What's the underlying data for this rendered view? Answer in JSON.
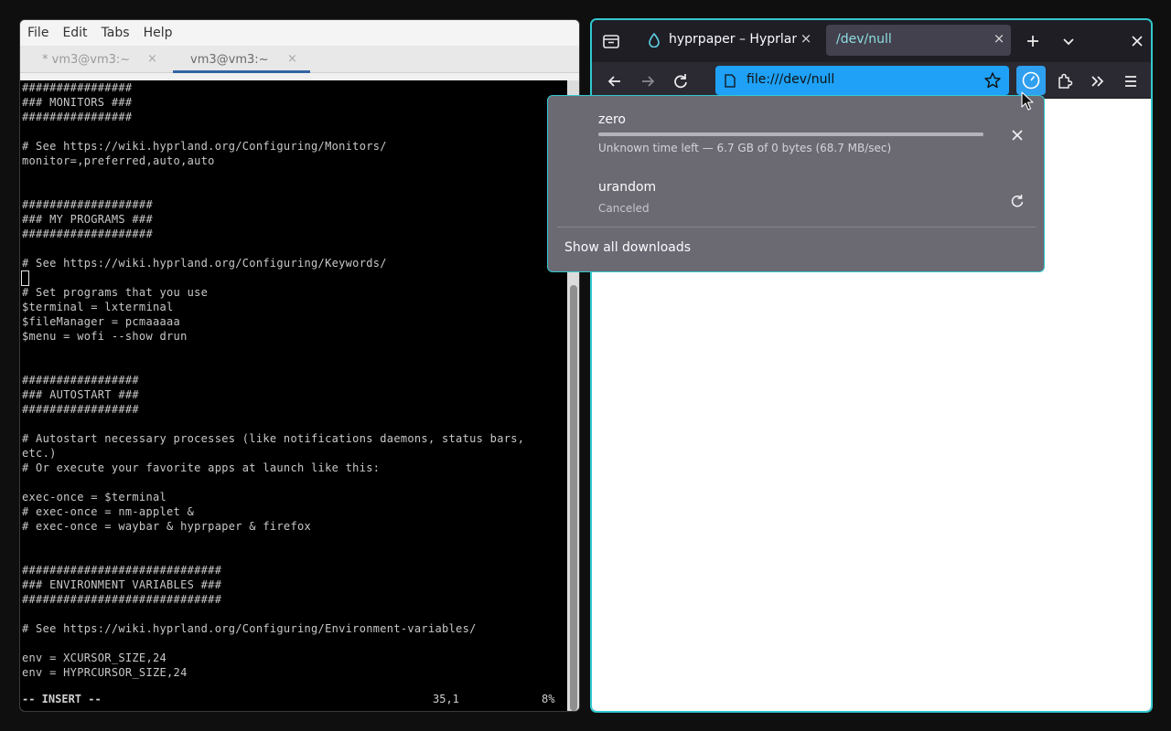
{
  "terminal": {
    "menu": [
      "File",
      "Edit",
      "Tabs",
      "Help"
    ],
    "tabs": [
      {
        "label": "* vm3@vm3:~",
        "close": "×"
      },
      {
        "label": "vm3@vm3:~",
        "close": "×"
      }
    ],
    "lines": [
      "################",
      "### MONITORS ###",
      "################",
      "",
      "# See https://wiki.hyprland.org/Configuring/Monitors/",
      "monitor=,preferred,auto,auto",
      "",
      "",
      "###################",
      "### MY PROGRAMS ###",
      "###################",
      "",
      "# See https://wiki.hyprland.org/Configuring/Keywords/",
      "",
      "# Set programs that you use",
      "$terminal = lxterminal",
      "$fileManager = pcmaaaaa",
      "$menu = wofi --show drun",
      "",
      "",
      "#################",
      "### AUTOSTART ###",
      "#################",
      "",
      "# Autostart necessary processes (like notifications daemons, status bars,",
      "etc.)",
      "# Or execute your favorite apps at launch like this:",
      "",
      "exec-once = $terminal",
      "# exec-once = nm-applet &",
      "# exec-once = waybar & hyprpaper & firefox",
      "",
      "",
      "#############################",
      "### ENVIRONMENT VARIABLES ###",
      "#############################",
      "",
      "# See https://wiki.hyprland.org/Configuring/Environment-variables/",
      "",
      "env = XCURSOR_SIZE,24",
      "env = HYPRCURSOR_SIZE,24"
    ],
    "status": {
      "mode": "-- INSERT --",
      "position": "35,1",
      "percent": "8%"
    }
  },
  "browser": {
    "tabs": [
      {
        "label": "hyprpaper – Hyprland",
        "close": "×",
        "icon": "droplet-icon"
      },
      {
        "label": "/dev/null",
        "close": "×"
      }
    ],
    "url": "file:///dev/null",
    "accent_color": "#32c8cf",
    "downloads": {
      "items": [
        {
          "name": "zero",
          "status": "Unknown time left — 6.7 GB of 0 bytes (68.7 MB/sec)",
          "progress": 1.0,
          "action": "close-icon"
        },
        {
          "name": "urandom",
          "status": "Canceled",
          "action": "retry-icon"
        }
      ],
      "show_all": "Show all downloads"
    }
  }
}
